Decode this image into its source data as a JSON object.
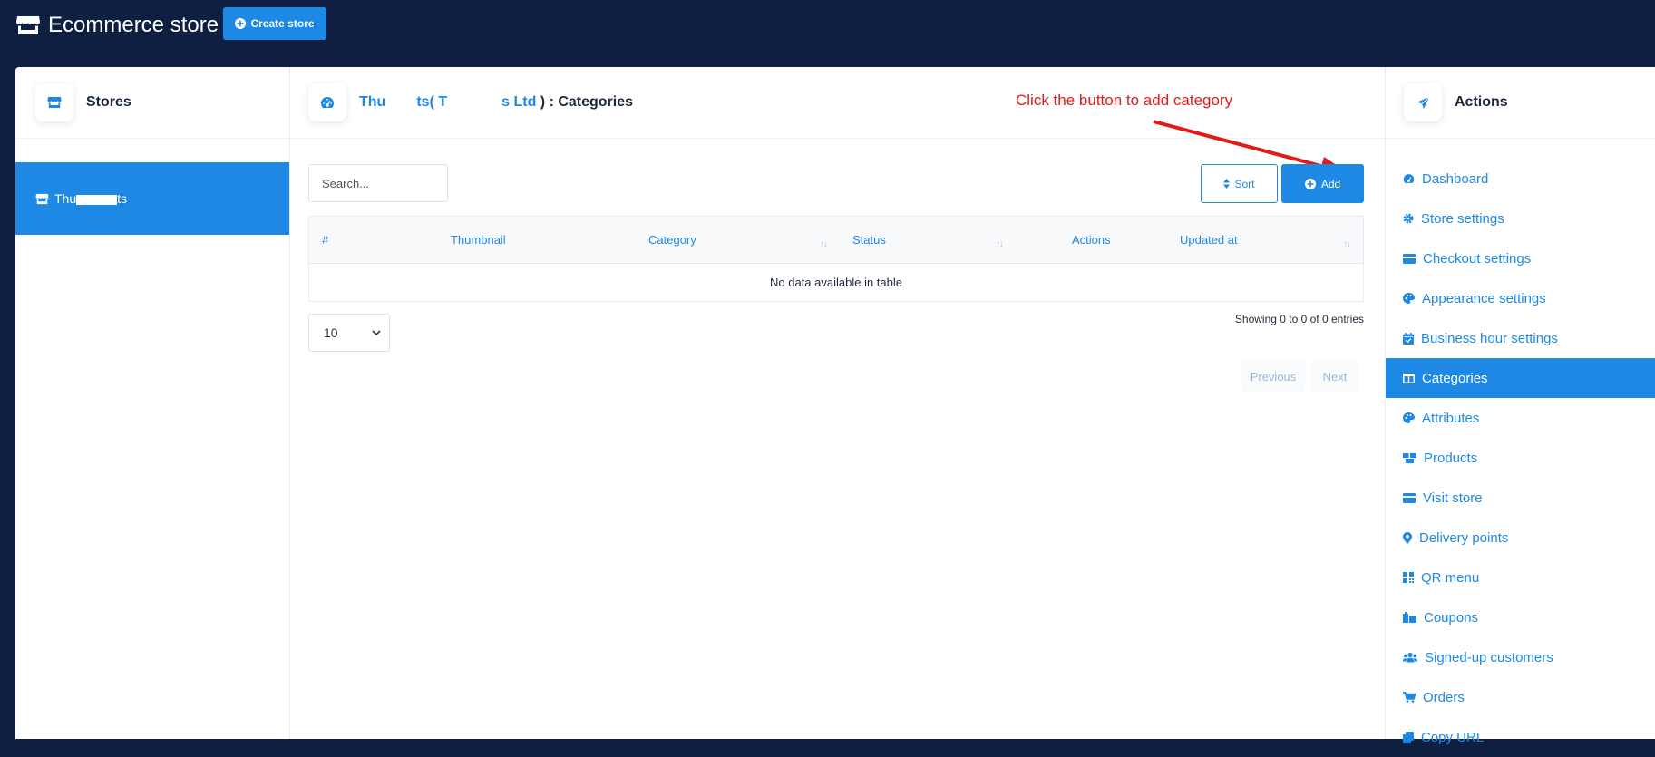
{
  "app": {
    "title": "Ecommerce store",
    "create_store_label": "Create store"
  },
  "colors": {
    "navy": "#0e1f42",
    "accent": "#1e88e5",
    "annotation": "#e31a1a"
  },
  "stores_panel": {
    "title": "Stores",
    "items": [
      {
        "label_start": "Thu",
        "label_end": "ts"
      }
    ]
  },
  "center": {
    "breadcrumb": {
      "store_start": "Thu",
      "store_end": "ts",
      "open_paren": "( ",
      "company_start": "T",
      "company_end": "s Ltd",
      "close_paren": " )",
      "section": " : Categories"
    },
    "annotation": "Click the button to add category",
    "search_placeholder": "Search...",
    "sort_label": "Sort",
    "add_label": "Add",
    "table": {
      "columns": [
        "#",
        "Thumbnail",
        "Category",
        "Status",
        "Actions",
        "Updated at"
      ],
      "empty_message": "No data available in table"
    },
    "page_length": "10",
    "info": "Showing 0 to 0 of 0 entries",
    "pager": {
      "previous": "Previous",
      "next": "Next"
    }
  },
  "actions_panel": {
    "title": "Actions",
    "active_item": "Categories",
    "items": [
      {
        "label": "Dashboard",
        "icon": "dashboard-icon"
      },
      {
        "label": "Store settings",
        "icon": "gear-icon"
      },
      {
        "label": "Checkout settings",
        "icon": "credit-card-icon"
      },
      {
        "label": "Appearance settings",
        "icon": "palette-icon"
      },
      {
        "label": "Business hour settings",
        "icon": "calendar-check-icon"
      },
      {
        "label": "Categories",
        "icon": "columns-icon"
      },
      {
        "label": "Attributes",
        "icon": "palette-icon"
      },
      {
        "label": "Products",
        "icon": "boxes-icon"
      },
      {
        "label": "Visit store",
        "icon": "card-icon"
      },
      {
        "label": "Delivery points",
        "icon": "map-marker-icon"
      },
      {
        "label": "QR menu",
        "icon": "qrcode-icon"
      },
      {
        "label": "Coupons",
        "icon": "coupons-icon"
      },
      {
        "label": "Signed-up customers",
        "icon": "users-icon"
      },
      {
        "label": "Orders",
        "icon": "cart-icon"
      },
      {
        "label": "Copy URL",
        "icon": "copy-icon"
      }
    ]
  }
}
